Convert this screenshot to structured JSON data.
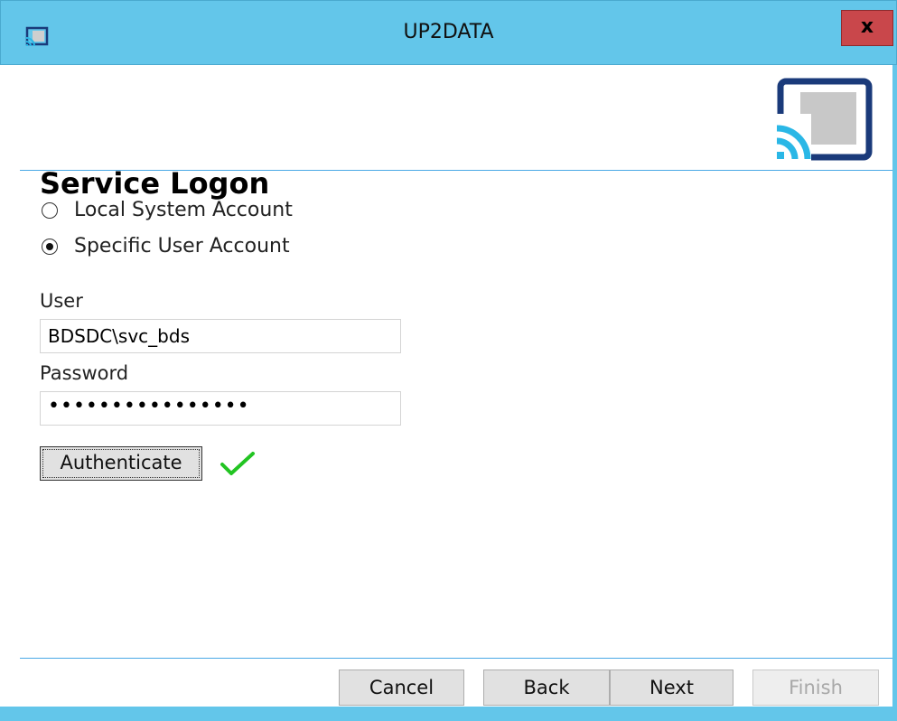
{
  "window": {
    "title": "UP2DATA",
    "close_label": "x"
  },
  "header": {
    "title": "Service Logon"
  },
  "account_options": [
    {
      "label": "Local System Account",
      "checked": false
    },
    {
      "label": "Specific User Account",
      "checked": true
    }
  ],
  "form": {
    "user_label": "User",
    "user_value": "BDSDC\\svc_bds",
    "password_label": "Password",
    "password_value": "••••••••••••••••",
    "authenticate_label": "Authenticate",
    "authenticated": true
  },
  "footer": {
    "cancel_label": "Cancel",
    "back_label": "Back",
    "next_label": "Next",
    "finish_label": "Finish"
  },
  "colors": {
    "titlebar": "#63c6ea",
    "close": "#c9474b",
    "accent_blue": "#1a3a7a",
    "logo_cyan": "#2ab7e6",
    "check_green": "#22c422"
  }
}
